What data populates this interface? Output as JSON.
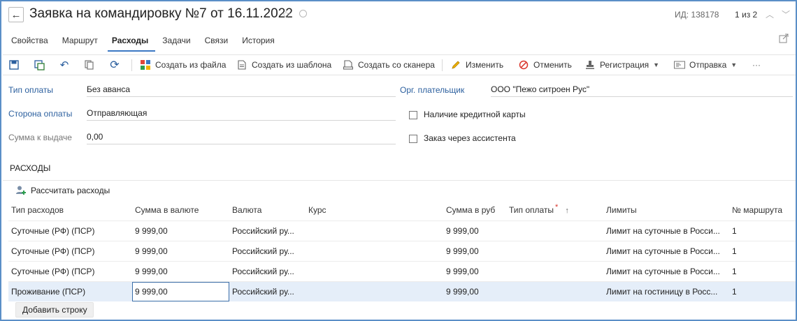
{
  "header": {
    "title": "Заявка на командировку №7 от 16.11.2022",
    "id_text": "ИД: 138178",
    "counter": "1 из 2",
    "back_icon": "←",
    "star_icon": "☆",
    "up_icon": "︿",
    "down_icon": "﹀"
  },
  "tabs": [
    {
      "label": "Свойства"
    },
    {
      "label": "Маршрут"
    },
    {
      "label": "Расходы",
      "active": true
    },
    {
      "label": "Задачи"
    },
    {
      "label": "Связи"
    },
    {
      "label": "История"
    }
  ],
  "toolbar": {
    "create_from_file": "Создать из файла",
    "create_from_template": "Создать из шаблона",
    "create_from_scanner": "Создать со сканера",
    "edit": "Изменить",
    "cancel": "Отменить",
    "registration": "Регистрация",
    "send": "Отправка",
    "more": "···"
  },
  "form": {
    "payment_type_label": "Тип оплаты",
    "payment_type_value": "Без аванса",
    "payer_side_label": "Сторона оплаты",
    "payer_side_value": "Отправляющая",
    "amount_label": "Сумма к выдаче",
    "amount_value": "0,00",
    "org_payer_label": "Орг. плательщик",
    "org_payer_value": "ООО \"Пежо ситроен Рус\"",
    "credit_card_label": "Наличие кредитной карты",
    "assistant_label": "Заказ через ассистента"
  },
  "expenses": {
    "section_title": "РАСХОДЫ",
    "calc_button": "Рассчитать расходы",
    "add_row_button": "Добавить строку",
    "columns": {
      "type": "Тип расходов",
      "amount_currency": "Сумма в валюте",
      "currency": "Валюта",
      "rate": "Курс",
      "amount_rub": "Сумма в руб",
      "payment_type": "Тип оплаты",
      "limits": "Лимиты",
      "route_no": "№ маршрута"
    },
    "rows": [
      {
        "type": "Суточные (РФ) (ПСР)",
        "amount_currency": "9 999,00",
        "currency": "Российский ру...",
        "rate": "",
        "amount_rub": "9 999,00",
        "payment_type": "",
        "limits": "Лимит на суточные в Росси...",
        "route_no": "1"
      },
      {
        "type": "Суточные (РФ) (ПСР)",
        "amount_currency": "9 999,00",
        "currency": "Российский ру...",
        "rate": "",
        "amount_rub": "9 999,00",
        "payment_type": "",
        "limits": "Лимит на суточные в Росси...",
        "route_no": "1"
      },
      {
        "type": "Суточные (РФ) (ПСР)",
        "amount_currency": "9 999,00",
        "currency": "Российский ру...",
        "rate": "",
        "amount_rub": "9 999,00",
        "payment_type": "",
        "limits": "Лимит на суточные в Росси...",
        "route_no": "1"
      },
      {
        "type": "Проживание (ПСР)",
        "amount_currency": "9 999,00",
        "currency": "Российский ру...",
        "rate": "",
        "amount_rub": "9 999,00",
        "payment_type": "",
        "limits": "Лимит на гостиницу в Росс...",
        "route_no": "1"
      }
    ]
  },
  "colors": {
    "accent": "#3b78c4",
    "label_blue": "#2b5f9e",
    "selected_row": "#e5eef9",
    "frame_border": "#5b8fc7"
  }
}
